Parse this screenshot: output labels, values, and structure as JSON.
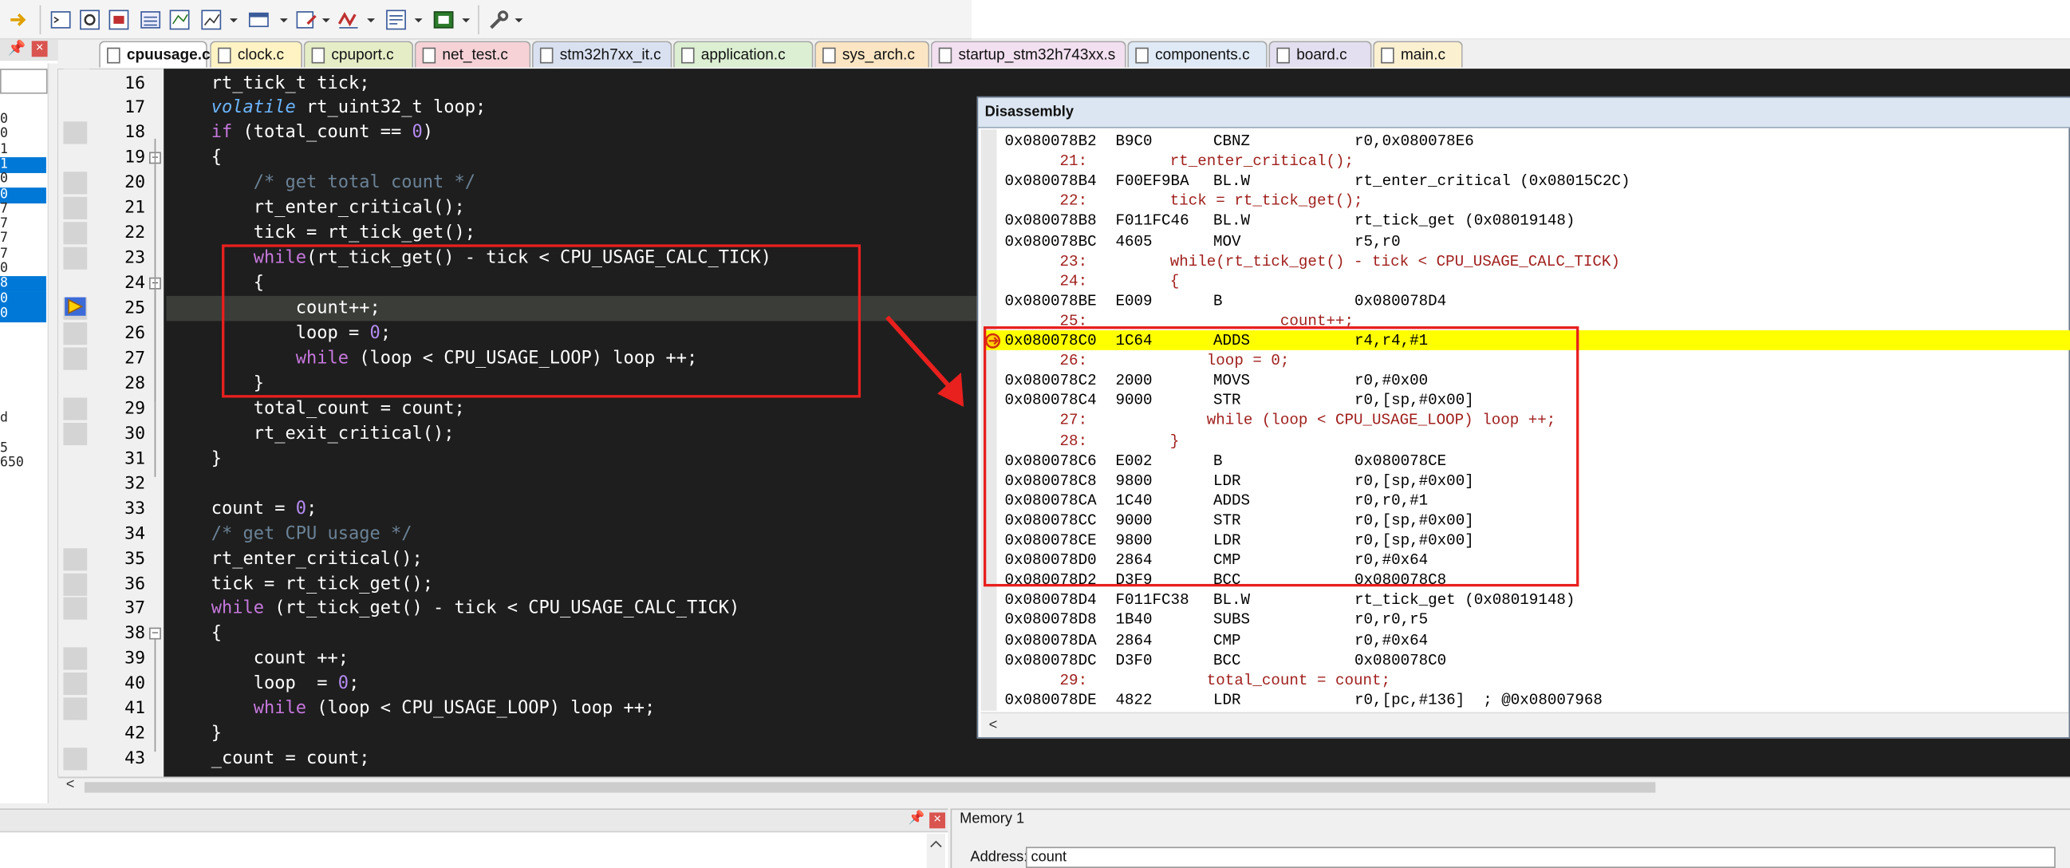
{
  "tabs": [
    {
      "label": "cpuusage.c",
      "color": "#ffffff",
      "active": true
    },
    {
      "label": "clock.c",
      "color": "#fff3c4"
    },
    {
      "label": "cpuport.c",
      "color": "#e5edc6"
    },
    {
      "label": "net_test.c",
      "color": "#f6d2d6"
    },
    {
      "label": "stm32h7xx_it.c",
      "color": "#d9e1f1"
    },
    {
      "label": "application.c",
      "color": "#dcefd2"
    },
    {
      "label": "sys_arch.c",
      "color": "#fbe5c2"
    },
    {
      "label": "startup_stm32h743xx.s",
      "color": "#f2dff0"
    },
    {
      "label": "components.c",
      "color": "#dfeaf6"
    },
    {
      "label": "board.c",
      "color": "#e4dff0"
    },
    {
      "label": "main.c",
      "color": "#fbf0d0"
    }
  ],
  "left_panel": {
    "rows": [
      "0",
      "0",
      "1",
      "1",
      "0",
      "0",
      "7",
      "7",
      "7",
      "7",
      "0",
      "8",
      "0",
      "0",
      "",
      "",
      "",
      "",
      "",
      "",
      "d",
      "",
      "5",
      "650"
    ],
    "selected": [
      3,
      5,
      11,
      12,
      13
    ]
  },
  "editor": {
    "current_line": 25,
    "lines": [
      {
        "n": "16",
        "code": "rt_tick_t tick;"
      },
      {
        "n": "17",
        "code": "volatile rt_uint32_t loop;"
      },
      {
        "n": "18",
        "code": "if (total_count == 0)"
      },
      {
        "n": "19",
        "code": "{"
      },
      {
        "n": "20",
        "code": "    /* get total count */"
      },
      {
        "n": "21",
        "code": "    rt_enter_critical();"
      },
      {
        "n": "22",
        "code": "    tick = rt_tick_get();"
      },
      {
        "n": "23",
        "code": "    while(rt_tick_get() - tick < CPU_USAGE_CALC_TICK)"
      },
      {
        "n": "24",
        "code": "    {"
      },
      {
        "n": "25",
        "code": "        count++;"
      },
      {
        "n": "26",
        "code": "        loop = 0;"
      },
      {
        "n": "27",
        "code": "        while (loop < CPU_USAGE_LOOP) loop ++;"
      },
      {
        "n": "28",
        "code": "    }"
      },
      {
        "n": "29",
        "code": "    total_count = count;"
      },
      {
        "n": "30",
        "code": "    rt_exit_critical();"
      },
      {
        "n": "31",
        "code": "}"
      },
      {
        "n": "32",
        "code": ""
      },
      {
        "n": "33",
        "code": "count = 0;"
      },
      {
        "n": "34",
        "code": "/* get CPU usage */"
      },
      {
        "n": "35",
        "code": "rt_enter_critical();"
      },
      {
        "n": "36",
        "code": "tick = rt_tick_get();"
      },
      {
        "n": "37",
        "code": "while (rt_tick_get() - tick < CPU_USAGE_CALC_TICK)"
      },
      {
        "n": "38",
        "code": "{"
      },
      {
        "n": "39",
        "code": "    count ++;"
      },
      {
        "n": "40",
        "code": "    loop  = 0;"
      },
      {
        "n": "41",
        "code": "    while (loop < CPU_USAGE_LOOP) loop ++;"
      },
      {
        "n": "42",
        "code": "}"
      },
      {
        "n": "43",
        "code": "_count = count;"
      }
    ]
  },
  "disassembly": {
    "title": "Disassembly",
    "scroll_label": "<",
    "rows": [
      {
        "t": "i",
        "addr": "0x080078B2",
        "hex": "B9C0",
        "mn": "CBNZ",
        "op": "r0,0x080078E6"
      },
      {
        "t": "s",
        "text": "      21:         rt_enter_critical();"
      },
      {
        "t": "i",
        "addr": "0x080078B4",
        "hex": "F00EF9BA",
        "mn": "BL.W",
        "op": "rt_enter_critical (0x08015C2C)"
      },
      {
        "t": "s",
        "text": "      22:         tick = rt_tick_get();"
      },
      {
        "t": "i",
        "addr": "0x080078B8",
        "hex": "F011FC46",
        "mn": "BL.W",
        "op": "rt_tick_get (0x08019148)"
      },
      {
        "t": "i",
        "addr": "0x080078BC",
        "hex": "4605",
        "mn": "MOV",
        "op": "r5,r0"
      },
      {
        "t": "s",
        "text": "      23:         while(rt_tick_get() - tick < CPU_USAGE_CALC_TICK)"
      },
      {
        "t": "s",
        "text": "      24:         {"
      },
      {
        "t": "i",
        "addr": "0x080078BE",
        "hex": "E009",
        "mn": "B",
        "op": "0x080078D4"
      },
      {
        "t": "s",
        "text": "      25:                     count++;"
      },
      {
        "t": "i",
        "addr": "0x080078C0",
        "hex": "1C64",
        "mn": "ADDS",
        "op": "r4,r4,#1",
        "hl": true
      },
      {
        "t": "s",
        "text": "      26:             loop = 0;"
      },
      {
        "t": "i",
        "addr": "0x080078C2",
        "hex": "2000",
        "mn": "MOVS",
        "op": "r0,#0x00"
      },
      {
        "t": "i",
        "addr": "0x080078C4",
        "hex": "9000",
        "mn": "STR",
        "op": "r0,[sp,#0x00]"
      },
      {
        "t": "s",
        "text": "      27:             while (loop < CPU_USAGE_LOOP) loop ++;"
      },
      {
        "t": "s",
        "text": "      28:         }"
      },
      {
        "t": "i",
        "addr": "0x080078C6",
        "hex": "E002",
        "mn": "B",
        "op": "0x080078CE"
      },
      {
        "t": "i",
        "addr": "0x080078C8",
        "hex": "9800",
        "mn": "LDR",
        "op": "r0,[sp,#0x00]"
      },
      {
        "t": "i",
        "addr": "0x080078CA",
        "hex": "1C40",
        "mn": "ADDS",
        "op": "r0,r0,#1"
      },
      {
        "t": "i",
        "addr": "0x080078CC",
        "hex": "9000",
        "mn": "STR",
        "op": "r0,[sp,#0x00]"
      },
      {
        "t": "i",
        "addr": "0x080078CE",
        "hex": "9800",
        "mn": "LDR",
        "op": "r0,[sp,#0x00]"
      },
      {
        "t": "i",
        "addr": "0x080078D0",
        "hex": "2864",
        "mn": "CMP",
        "op": "r0,#0x64"
      },
      {
        "t": "i",
        "addr": "0x080078D2",
        "hex": "D3F9",
        "mn": "BCC",
        "op": "0x080078C8"
      },
      {
        "t": "i",
        "addr": "0x080078D4",
        "hex": "F011FC38",
        "mn": "BL.W",
        "op": "rt_tick_get (0x08019148)"
      },
      {
        "t": "i",
        "addr": "0x080078D8",
        "hex": "1B40",
        "mn": "SUBS",
        "op": "r0,r0,r5"
      },
      {
        "t": "i",
        "addr": "0x080078DA",
        "hex": "2864",
        "mn": "CMP",
        "op": "r0,#0x64"
      },
      {
        "t": "i",
        "addr": "0x080078DC",
        "hex": "D3F0",
        "mn": "BCC",
        "op": "0x080078C0"
      },
      {
        "t": "s",
        "text": "      29:             total_count = count;"
      },
      {
        "t": "i",
        "addr": "0x080078DE",
        "hex": "4822",
        "mn": "LDR",
        "op": "r0,[pc,#136]  ; @0x08007968"
      }
    ]
  },
  "memory": {
    "title": "Memory 1",
    "address_label": "Address:",
    "address_value": "count"
  },
  "colors": {
    "annotation_red": "#e8201e",
    "highlight": "#ffff00",
    "editor_bg": "#1e1e1e"
  }
}
